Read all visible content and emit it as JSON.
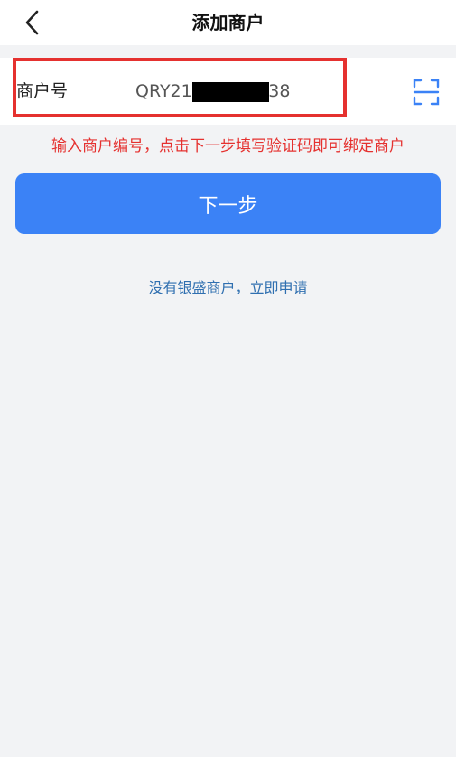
{
  "header": {
    "title": "添加商户",
    "back_icon": "chevron-left-icon"
  },
  "merchant_field": {
    "label": "商户号",
    "value": "QRY21          5238",
    "scan_icon": "scan-icon"
  },
  "hint": {
    "text": "输入商户编号，点击下一步填写验证码即可绑定商户"
  },
  "actions": {
    "next_label": "下一步",
    "apply_link": "没有银盛商户，立即申请"
  },
  "colors": {
    "accent": "#3b82f6",
    "warning": "#e5312f",
    "link": "#2f6fb0",
    "background": "#f2f3f5"
  }
}
